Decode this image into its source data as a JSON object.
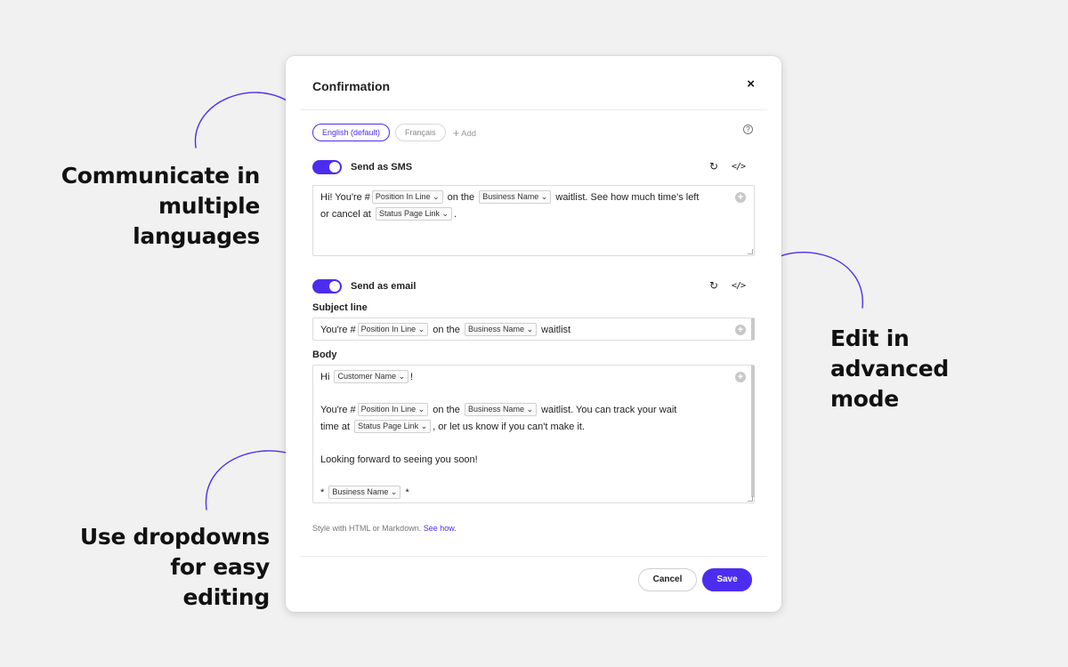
{
  "callouts": {
    "languages": [
      "Communicate in",
      "multiple",
      "languages"
    ],
    "advanced": [
      "Edit in",
      "advanced",
      "mode"
    ],
    "dropdowns": [
      "Use dropdowns",
      "for easy",
      "editing"
    ]
  },
  "modal": {
    "title": "Confirmation",
    "close": "×",
    "languages": [
      {
        "label": "English (default)",
        "active": true
      },
      {
        "label": "Français",
        "active": false
      }
    ],
    "add_language": "Add",
    "help": "?"
  },
  "sms": {
    "label": "Send as SMS",
    "enabled": true,
    "message": {
      "t1": "Hi! You're #",
      "c1": "Position In Line",
      "t2": "on the",
      "c2": "Business Name",
      "t3": "waitlist. See how much time's left",
      "t4": "or cancel at",
      "c3": "Status Page Link",
      "t5": "."
    }
  },
  "email": {
    "label": "Send as email",
    "enabled": true,
    "subject_label": "Subject line",
    "subject": {
      "t1": "You're #",
      "c1": "Position In Line",
      "t2": "on the",
      "c2": "Business Name",
      "t3": "waitlist"
    },
    "body_label": "Body",
    "body": {
      "hi": "Hi",
      "c_customer": "Customer Name",
      "excl": "!",
      "t1": "You're #",
      "c1": "Position In Line",
      "t2": "on the",
      "c2": "Business Name",
      "t3": "waitlist. You can track your wait",
      "t4": "time at",
      "c3": "Status Page Link",
      "t5": ", or let us know if you can't make it.",
      "t6": "Looking forward to seeing you soon!",
      "star": "*",
      "c4": "Business Name"
    }
  },
  "hint": {
    "text": "Style with HTML or Markdown.",
    "link": "See how."
  },
  "buttons": {
    "cancel": "Cancel",
    "save": "Save"
  },
  "colors": {
    "accent": "#4c2df0",
    "background": "#f1f1f1"
  },
  "icons": {
    "reset": "reset-icon",
    "code": "code-icon",
    "plus": "plus-icon",
    "help": "help-icon",
    "close": "close-icon"
  }
}
